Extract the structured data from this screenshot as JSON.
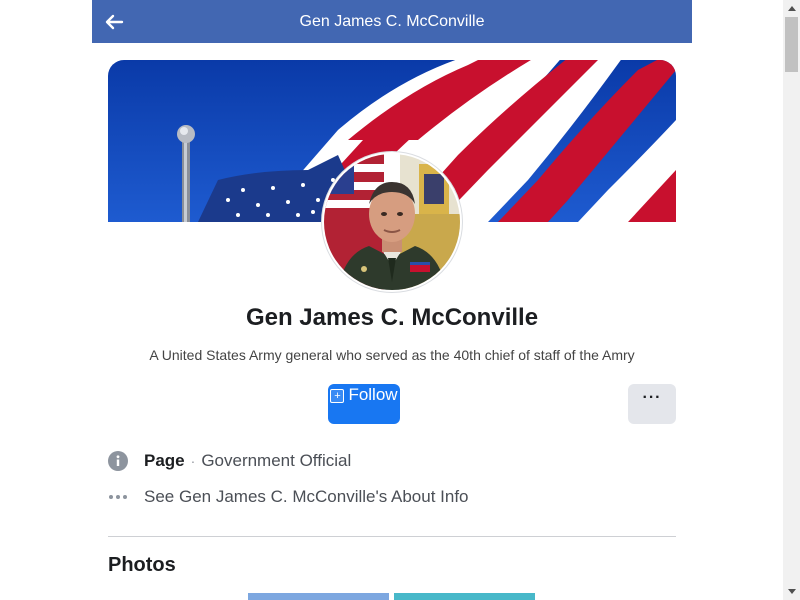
{
  "header": {
    "title": "Gen James C. McConville",
    "back_icon": "arrow-left-icon",
    "background_color": "#4267b2"
  },
  "profile": {
    "name": "Gen James C. McConville",
    "description": "A United States Army general who served as the 40th chief of staff of the Amry",
    "cover_image": "american-flag-cover",
    "avatar_image": "general-portrait-avatar"
  },
  "actions": {
    "follow_label": "Follow",
    "follow_icon": "plus-square-icon",
    "more_label": "···",
    "primary_color": "#1877f2"
  },
  "info": {
    "page_label": "Page",
    "separator": "·",
    "page_category": "Government Official",
    "about_link": "See Gen James C. McConville's About Info"
  },
  "photos": {
    "heading": "Photos"
  }
}
